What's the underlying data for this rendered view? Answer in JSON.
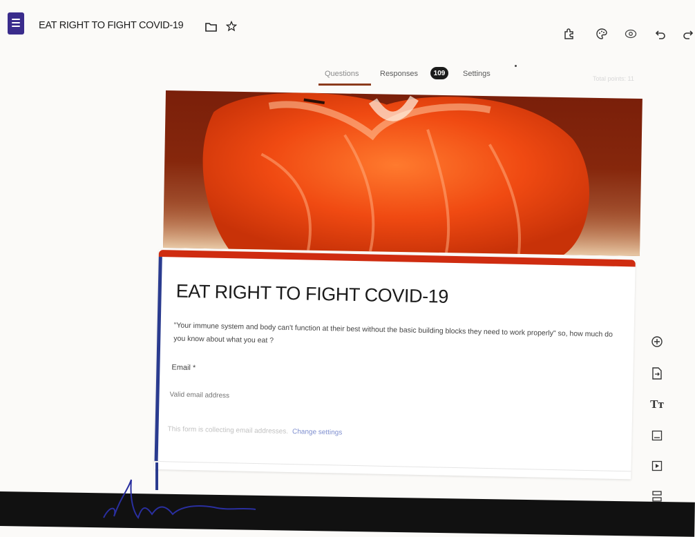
{
  "app": {
    "title": "EAT RIGHT TO FIGHT COVID-19",
    "icons": [
      "forms-app-icon",
      "folder-icon",
      "star-icon"
    ]
  },
  "toolbar": {
    "icons": [
      "addon-icon",
      "palette-icon",
      "preview-eye-icon",
      "undo-icon",
      "redo-icon"
    ]
  },
  "tabs": [
    {
      "label": "Questions",
      "active": true
    },
    {
      "label": "Responses",
      "badge": "109"
    },
    {
      "label": "Settings"
    }
  ],
  "points_text": "Total points: 11",
  "header_image": {
    "subject": "orange segment close-up"
  },
  "form": {
    "title": "EAT RIGHT TO FIGHT COVID-19",
    "description": "\"Your immune system and body can't function at their best without the basic building blocks they need to work properly\" so, how much do you know about what you eat ?",
    "email_label": "Email *",
    "email_placeholder": "Valid email address",
    "collect_note": "This form is collecting email addresses.",
    "change_link": "Change settings"
  },
  "side_toolbar": {
    "items": [
      {
        "icon": "add-question-icon"
      },
      {
        "icon": "import-questions-icon"
      },
      {
        "icon": "title-text-icon",
        "glyph": "Tт"
      },
      {
        "icon": "image-icon"
      },
      {
        "icon": "video-icon"
      },
      {
        "icon": "section-icon"
      }
    ]
  },
  "colors": {
    "accent": "#cf2c10",
    "left_bar": "#2a3b8f",
    "tab_underline": "#8b3a1c",
    "link": "#7f8fcf"
  }
}
